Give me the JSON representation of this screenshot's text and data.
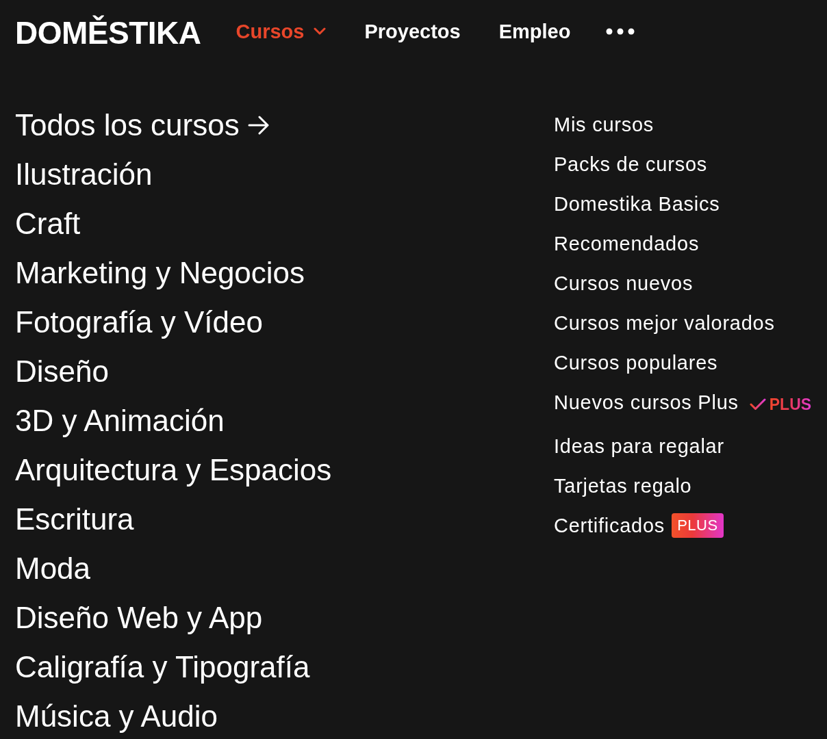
{
  "logo": {
    "text": "DOMĚSTIKA"
  },
  "nav": [
    {
      "kind": "dropdown",
      "label": "Cursos",
      "selected": true
    },
    {
      "kind": "link",
      "label": "Proyectos",
      "selected": false
    },
    {
      "kind": "link",
      "label": "Empleo",
      "selected": false
    },
    {
      "kind": "more",
      "selected": false
    }
  ],
  "categories": [
    {
      "kind": "all",
      "label": "Todos los cursos"
    },
    {
      "kind": "category",
      "label": "Ilustración"
    },
    {
      "kind": "category",
      "label": "Craft"
    },
    {
      "kind": "category",
      "label": "Marketing y Negocios"
    },
    {
      "kind": "category",
      "label": "Fotografía y Vídeo"
    },
    {
      "kind": "category",
      "label": "Diseño"
    },
    {
      "kind": "category",
      "label": "3D y Animación"
    },
    {
      "kind": "category",
      "label": "Arquitectura y Espacios"
    },
    {
      "kind": "category",
      "label": "Escritura"
    },
    {
      "kind": "category",
      "label": "Moda"
    },
    {
      "kind": "category",
      "label": "Diseño Web y App"
    },
    {
      "kind": "category",
      "label": "Caligrafía y Tipografía"
    },
    {
      "kind": "category",
      "label": "Música y Audio"
    }
  ],
  "shortcuts": [
    {
      "kind": "link",
      "label": "Mis cursos"
    },
    {
      "kind": "link",
      "label": "Packs de cursos"
    },
    {
      "kind": "link",
      "label": "Domestika Basics"
    },
    {
      "kind": "link",
      "label": "Recomendados"
    },
    {
      "kind": "link",
      "label": "Cursos nuevos"
    },
    {
      "kind": "link",
      "label": "Cursos mejor valorados"
    },
    {
      "kind": "link",
      "label": "Cursos populares"
    },
    {
      "kind": "plus-check",
      "label": "Nuevos cursos Plus",
      "badge": "PLUS"
    },
    {
      "kind": "link",
      "label": "Ideas para regalar"
    },
    {
      "kind": "link",
      "label": "Tarjetas regalo"
    },
    {
      "kind": "plus-tag",
      "label": "Certificados",
      "badge": "PLUS"
    }
  ]
}
